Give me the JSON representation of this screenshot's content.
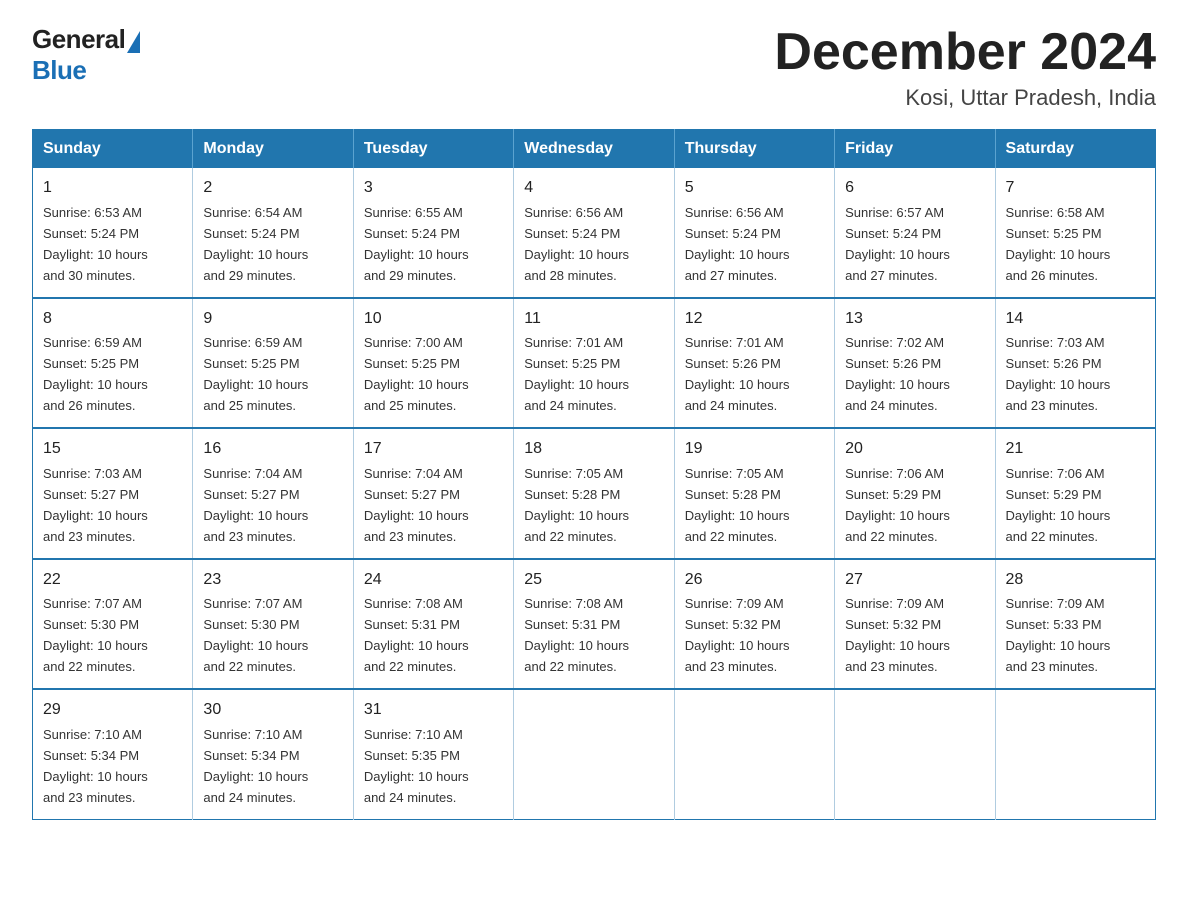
{
  "logo": {
    "general": "General",
    "blue": "Blue",
    "triangle": true
  },
  "title": "December 2024",
  "subtitle": "Kosi, Uttar Pradesh, India",
  "header": {
    "days": [
      "Sunday",
      "Monday",
      "Tuesday",
      "Wednesday",
      "Thursday",
      "Friday",
      "Saturday"
    ]
  },
  "weeks": [
    [
      {
        "day": "1",
        "sunrise": "6:53 AM",
        "sunset": "5:24 PM",
        "daylight": "10 hours and 30 minutes."
      },
      {
        "day": "2",
        "sunrise": "6:54 AM",
        "sunset": "5:24 PM",
        "daylight": "10 hours and 29 minutes."
      },
      {
        "day": "3",
        "sunrise": "6:55 AM",
        "sunset": "5:24 PM",
        "daylight": "10 hours and 29 minutes."
      },
      {
        "day": "4",
        "sunrise": "6:56 AM",
        "sunset": "5:24 PM",
        "daylight": "10 hours and 28 minutes."
      },
      {
        "day": "5",
        "sunrise": "6:56 AM",
        "sunset": "5:24 PM",
        "daylight": "10 hours and 27 minutes."
      },
      {
        "day": "6",
        "sunrise": "6:57 AM",
        "sunset": "5:24 PM",
        "daylight": "10 hours and 27 minutes."
      },
      {
        "day": "7",
        "sunrise": "6:58 AM",
        "sunset": "5:25 PM",
        "daylight": "10 hours and 26 minutes."
      }
    ],
    [
      {
        "day": "8",
        "sunrise": "6:59 AM",
        "sunset": "5:25 PM",
        "daylight": "10 hours and 26 minutes."
      },
      {
        "day": "9",
        "sunrise": "6:59 AM",
        "sunset": "5:25 PM",
        "daylight": "10 hours and 25 minutes."
      },
      {
        "day": "10",
        "sunrise": "7:00 AM",
        "sunset": "5:25 PM",
        "daylight": "10 hours and 25 minutes."
      },
      {
        "day": "11",
        "sunrise": "7:01 AM",
        "sunset": "5:25 PM",
        "daylight": "10 hours and 24 minutes."
      },
      {
        "day": "12",
        "sunrise": "7:01 AM",
        "sunset": "5:26 PM",
        "daylight": "10 hours and 24 minutes."
      },
      {
        "day": "13",
        "sunrise": "7:02 AM",
        "sunset": "5:26 PM",
        "daylight": "10 hours and 24 minutes."
      },
      {
        "day": "14",
        "sunrise": "7:03 AM",
        "sunset": "5:26 PM",
        "daylight": "10 hours and 23 minutes."
      }
    ],
    [
      {
        "day": "15",
        "sunrise": "7:03 AM",
        "sunset": "5:27 PM",
        "daylight": "10 hours and 23 minutes."
      },
      {
        "day": "16",
        "sunrise": "7:04 AM",
        "sunset": "5:27 PM",
        "daylight": "10 hours and 23 minutes."
      },
      {
        "day": "17",
        "sunrise": "7:04 AM",
        "sunset": "5:27 PM",
        "daylight": "10 hours and 23 minutes."
      },
      {
        "day": "18",
        "sunrise": "7:05 AM",
        "sunset": "5:28 PM",
        "daylight": "10 hours and 22 minutes."
      },
      {
        "day": "19",
        "sunrise": "7:05 AM",
        "sunset": "5:28 PM",
        "daylight": "10 hours and 22 minutes."
      },
      {
        "day": "20",
        "sunrise": "7:06 AM",
        "sunset": "5:29 PM",
        "daylight": "10 hours and 22 minutes."
      },
      {
        "day": "21",
        "sunrise": "7:06 AM",
        "sunset": "5:29 PM",
        "daylight": "10 hours and 22 minutes."
      }
    ],
    [
      {
        "day": "22",
        "sunrise": "7:07 AM",
        "sunset": "5:30 PM",
        "daylight": "10 hours and 22 minutes."
      },
      {
        "day": "23",
        "sunrise": "7:07 AM",
        "sunset": "5:30 PM",
        "daylight": "10 hours and 22 minutes."
      },
      {
        "day": "24",
        "sunrise": "7:08 AM",
        "sunset": "5:31 PM",
        "daylight": "10 hours and 22 minutes."
      },
      {
        "day": "25",
        "sunrise": "7:08 AM",
        "sunset": "5:31 PM",
        "daylight": "10 hours and 22 minutes."
      },
      {
        "day": "26",
        "sunrise": "7:09 AM",
        "sunset": "5:32 PM",
        "daylight": "10 hours and 23 minutes."
      },
      {
        "day": "27",
        "sunrise": "7:09 AM",
        "sunset": "5:32 PM",
        "daylight": "10 hours and 23 minutes."
      },
      {
        "day": "28",
        "sunrise": "7:09 AM",
        "sunset": "5:33 PM",
        "daylight": "10 hours and 23 minutes."
      }
    ],
    [
      {
        "day": "29",
        "sunrise": "7:10 AM",
        "sunset": "5:34 PM",
        "daylight": "10 hours and 23 minutes."
      },
      {
        "day": "30",
        "sunrise": "7:10 AM",
        "sunset": "5:34 PM",
        "daylight": "10 hours and 24 minutes."
      },
      {
        "day": "31",
        "sunrise": "7:10 AM",
        "sunset": "5:35 PM",
        "daylight": "10 hours and 24 minutes."
      },
      null,
      null,
      null,
      null
    ]
  ],
  "labels": {
    "sunrise": "Sunrise:",
    "sunset": "Sunset:",
    "daylight": "Daylight:"
  }
}
